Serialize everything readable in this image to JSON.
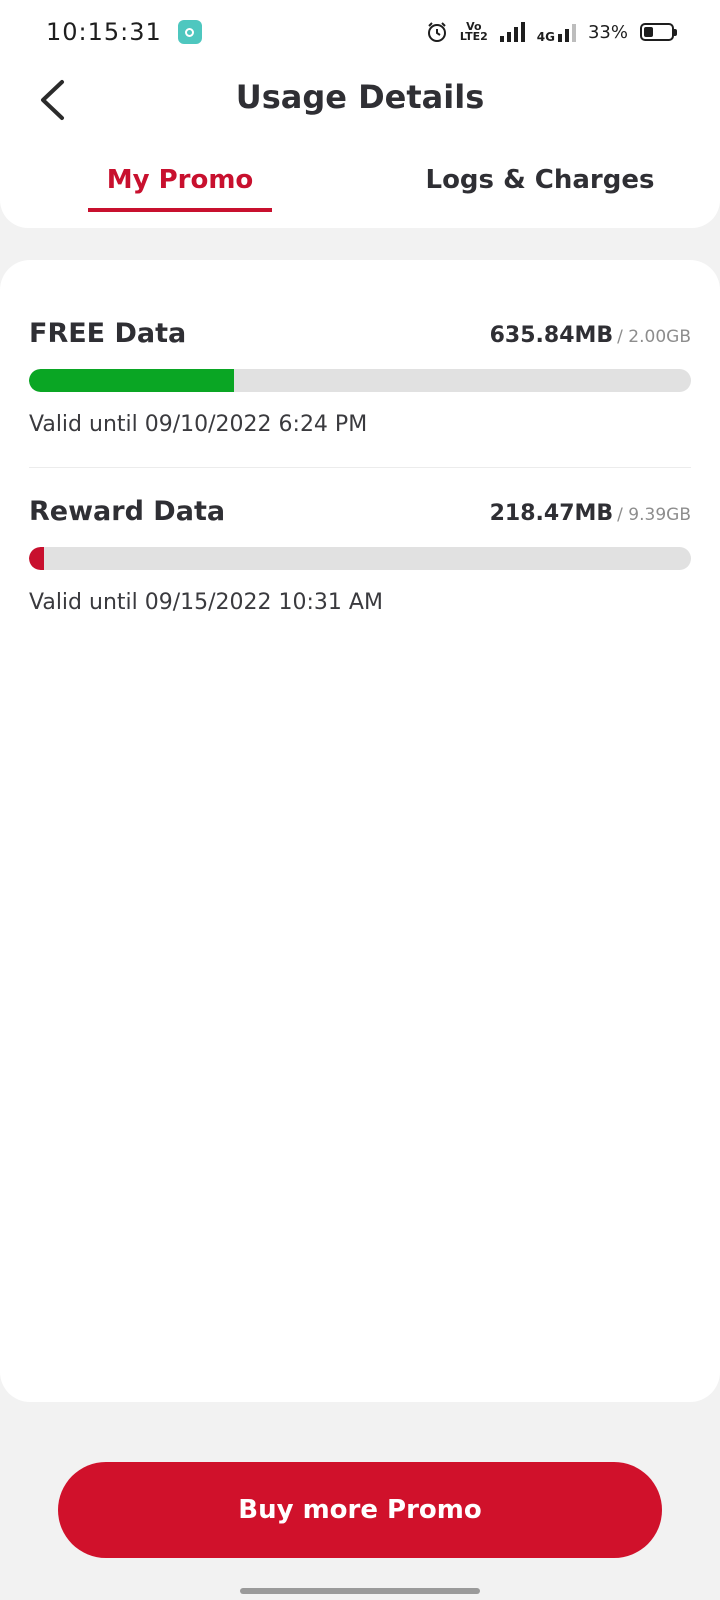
{
  "status_bar": {
    "time": "10:15:31",
    "volte_top": "Vo",
    "volte_bottom": "LTE2",
    "network": "4G",
    "battery": "33%",
    "battery_level": 0.33
  },
  "header": {
    "title": "Usage Details",
    "tabs": [
      {
        "label": "My Promo",
        "active": true
      },
      {
        "label": "Logs & Charges",
        "active": false
      }
    ]
  },
  "usage": [
    {
      "name": "FREE Data",
      "used": "635.84MB",
      "total": "/ 2.00GB",
      "fraction": 0.31,
      "bar_color": "#0aa624",
      "valid": "Valid until 09/10/2022 6:24 PM"
    },
    {
      "name": "Reward Data",
      "used": "218.47MB",
      "total": "/ 9.39GB",
      "fraction": 0.023,
      "bar_color": "#c8102e",
      "valid": "Valid until 09/15/2022 10:31 AM"
    }
  ],
  "footer": {
    "buy_label": "Buy more Promo"
  },
  "colors": {
    "accent": "#c8102e",
    "button": "#d0112b"
  }
}
